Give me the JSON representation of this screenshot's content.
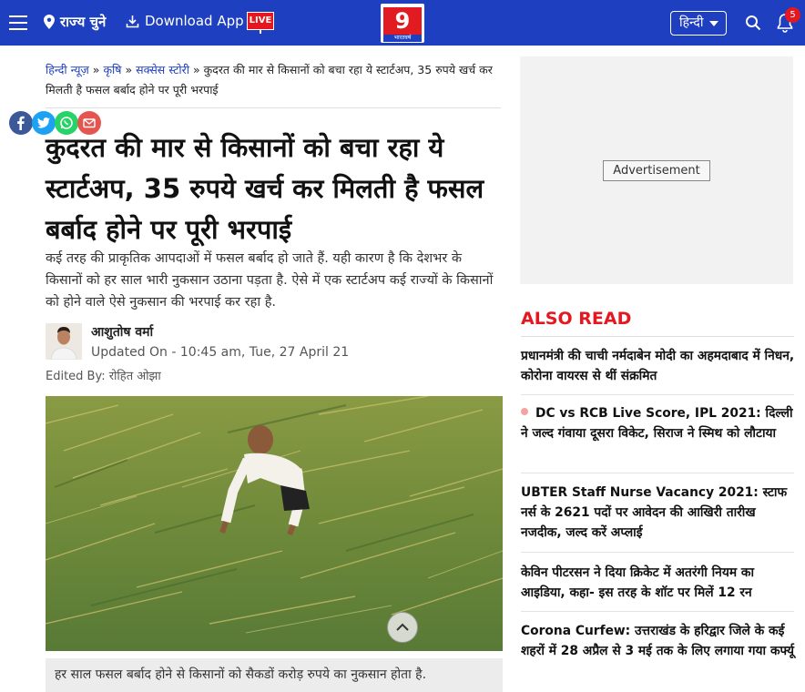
{
  "header": {
    "state_label": "राज्य चुने",
    "download_label": "Download App",
    "live_label": "LIVE",
    "logo_text": "9",
    "logo_sub": "भारतवर्ष",
    "language": "हिन्दी",
    "notification_count": "5",
    "brand_color": "#1e3fbf",
    "accent_color": "#e5171f"
  },
  "breadcrumb": {
    "items": [
      "हिन्दी न्यूज़",
      "कृषि",
      "सक्सेस स्टोरी"
    ],
    "separator": "»",
    "current": "कुदरत की मार से किसानों को बचा रहा ये स्टार्टअप, 35 रुपये खर्च कर मिलती है फसल बर्बाद होने पर पूरी भरपाई"
  },
  "share": [
    "facebook-icon",
    "twitter-icon",
    "whatsapp-icon",
    "mail-icon"
  ],
  "article": {
    "headline": "कुदरत की मार से किसानों को बचा रहा ये स्टार्टअप, 35 रुपये खर्च कर मिलती है फसल बर्बाद होने पर पूरी भरपाई",
    "summary": "कई तरह की प्राकृतिक आपदाओं में फसल बर्बाद हो जाते हैं. यही कारण है कि देशभर के किसानों को हर साल भारी नुकसान उठाना पड़ता है. ऐसे में एक स्टार्टअप कई राज्यों के किसानों को होने वाले ऐसे नुकसान की भरपाई कर रहा है.",
    "author": "आशुतोष वर्मा",
    "updated": "Updated On - 10:45 am, Tue, 27 April 21",
    "edited_by": "Edited By: रोहित ओझा",
    "image_caption": "हर साल फसल बर्बाद होने से किसानों को सैकडों करोड़ रुपये का नुकसान होता है."
  },
  "sidebar": {
    "ad_label": "Advertisement",
    "also_read_title": "ALSO READ",
    "items": [
      "प्रधानमंत्री की चाची नर्मदाबेन मोदी का अहमदाबाद में निधन, कोरोना वायरस से थीं संक्रमित",
      "DC vs RCB Live Score, IPL 2021: दिल्ली ने जल्द गंवाया दूसरा विकेट, सिराज ने स्मिथ को लौटाया",
      "UBTER Staff Nurse Vacancy 2021: स्टाफ नर्स के 2621 पदों पर आवेदन की आखिरी तारीख नजदीक, जल्द करें अप्लाई",
      "केविन पीटरसन ने दिया क्रिकेट में अतरंगी नियम का आइडिया, कहा- इस तरह के शॉट पर मिलें 12 रन",
      "Corona Curfew: उत्तराखंड के हरिद्वार जिले के कई शहरों में 28 अप्रैल से 3 मई तक के लिए लगाया गया कर्फ्यू"
    ]
  }
}
